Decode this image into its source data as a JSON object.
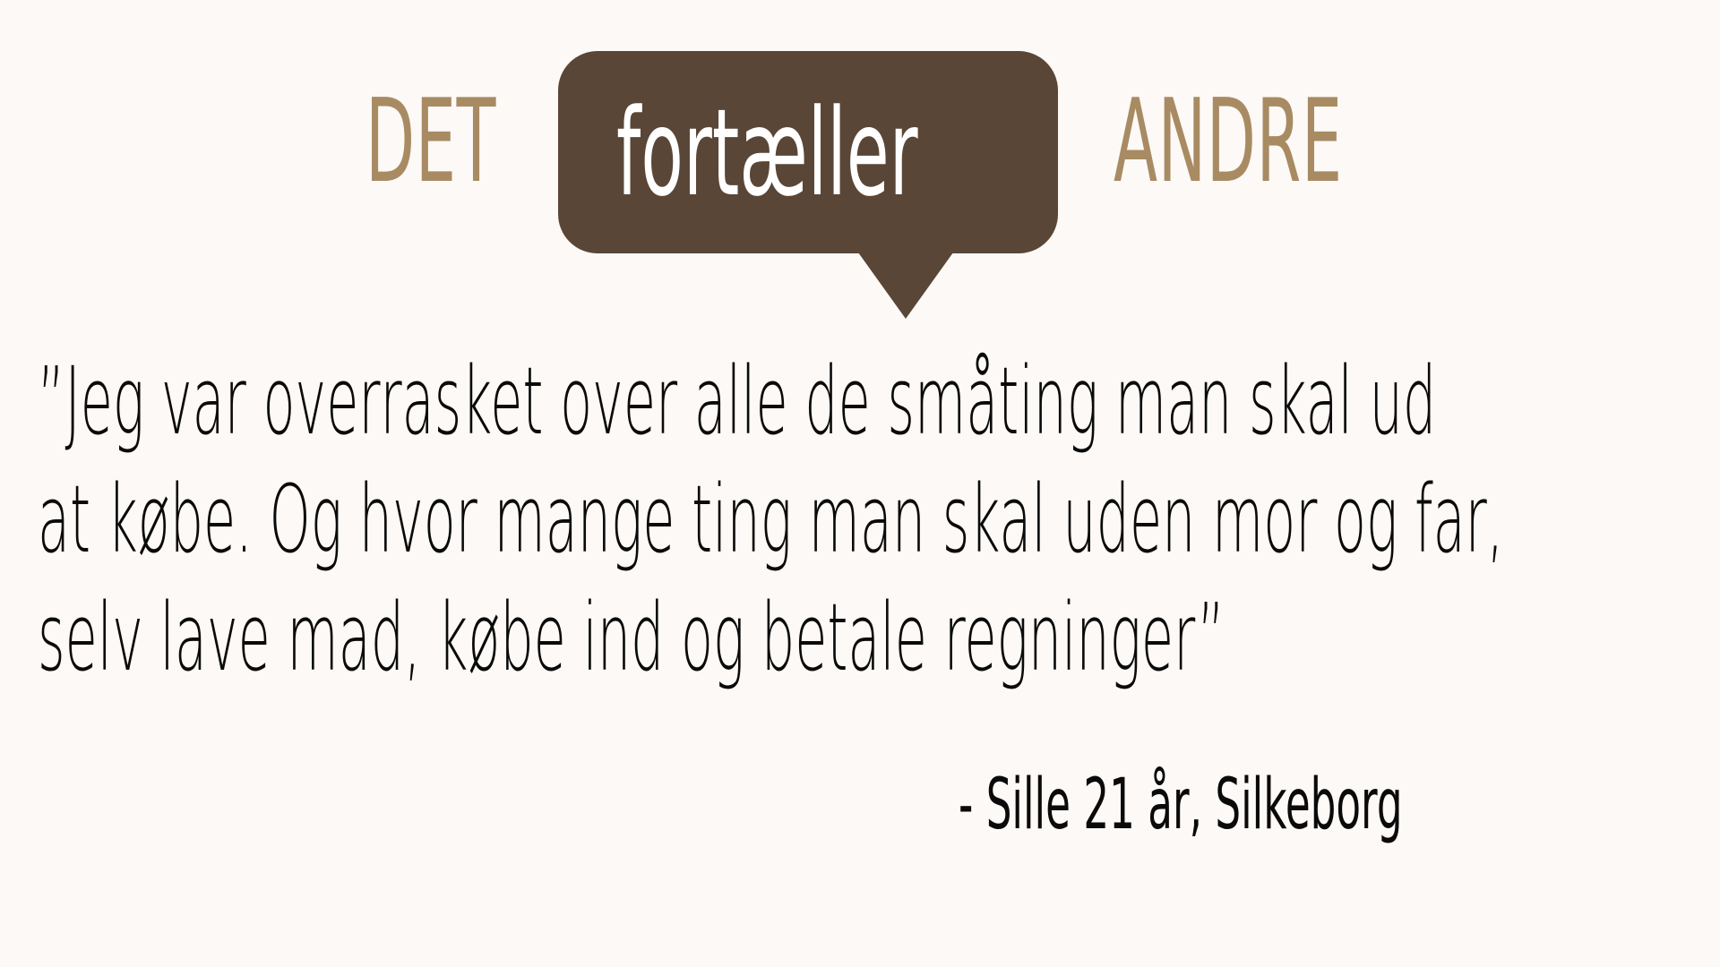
{
  "heading": {
    "word_left": "DET",
    "bubble_word": "fortæller",
    "word_right": "ANDRE"
  },
  "quote": {
    "lines": [
      "”Jeg var overrasket over alle de småting man skal ud",
      "at købe. Og hvor mange ting man skal uden mor og far,",
      "selv lave mad, købe ind og betale regninger”"
    ]
  },
  "attribution": "- Sille 21 år, Silkeborg",
  "colors": {
    "background": "#fcf9f6",
    "heading_gold": "#a88b63",
    "bubble_brown": "#5a4636",
    "text": "#0a0a0a"
  }
}
